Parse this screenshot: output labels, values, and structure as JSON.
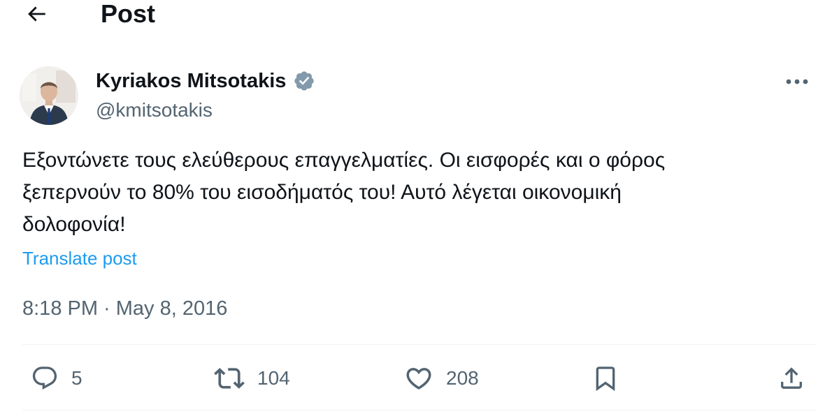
{
  "header": {
    "title": "Post",
    "back_icon": "arrow-left-icon"
  },
  "author": {
    "name": "Kyriakos Mitsotakis",
    "handle": "@kmitsotakis",
    "verified": true,
    "verified_color": "#829aab"
  },
  "post": {
    "text": "Εξοντώνετε τους ελεύθερους επαγγελματίες. Οι εισφορές και ο φόρος\nξεπερνούν το 80% του εισοδήματός του! Αυτό λέγεται οικονομική\nδολοφονία!",
    "translate_label": "Translate post",
    "timestamp": "8:18 PM · May 8, 2016"
  },
  "actions": {
    "replies": "5",
    "reposts": "104",
    "likes": "208",
    "bookmark_icon": "bookmark-icon",
    "share_icon": "share-icon"
  },
  "colors": {
    "text": "#0f1419",
    "secondary": "#536471",
    "link": "#1d9bf0",
    "divider": "#eff3f4"
  }
}
